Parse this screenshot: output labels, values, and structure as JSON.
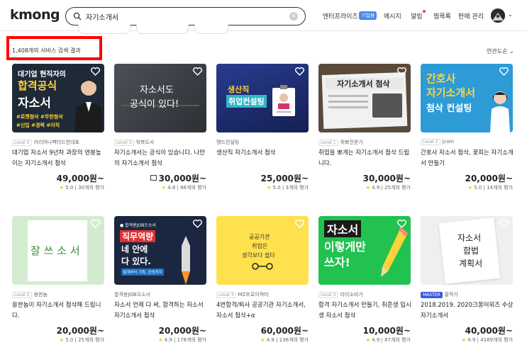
{
  "header": {
    "logo": "kmong",
    "search_value": "자기소개서",
    "search_placeholder": "",
    "nav": {
      "enterprise": "엔터프라이즈",
      "enterprise_badge": "기업용",
      "messages": "메시지",
      "alarm": "알림",
      "favorites": "찜목록",
      "sell": "판매 관리"
    }
  },
  "results": {
    "count_label": "1,408개의 서비스 검색 결과",
    "sort_label": "연관도순"
  },
  "cards": [
    {
      "thumb_lines": [
        "대기업 현직자의",
        "합격공식",
        "자소서",
        "#로켓첨삭 #무한첨삭",
        "#신입 #경력 #이직"
      ],
      "level": "Level 2",
      "seller": "카리어나벽터드한대표",
      "title": "대기업 자소서 9년차 과장의 연봉높이는 자기소개서 첨삭",
      "price": "49,000원~",
      "rating": "5.0",
      "reviews": "30개의 평가"
    },
    {
      "thumb_lines": [
        "자소서도",
        "공식이 있다!"
      ],
      "level": "Level 3",
      "seller": "워북도사",
      "title": "자기소개서는 공식이 있습니다. 나만의 자기소개서 첨삭",
      "price": "30,000원~",
      "rating": "4.8",
      "reviews": "86개의 평가"
    },
    {
      "thumb_lines": [
        "생산직",
        "취업컨설팅"
      ],
      "level": "",
      "seller": "땡드컨설팅",
      "title": "생산직 자기소개서 첨삭",
      "price": "25,000원~",
      "rating": "5.0",
      "reviews": "3개의 평가"
    },
    {
      "thumb_lines": [
        "자기소개서 첨삭"
      ],
      "level": "Level 1",
      "seller": "취뽀전문가",
      "title": "취업을 뽀개는 자기소개서 첨삭 드립니다.",
      "price": "30,000원~",
      "rating": "4.9",
      "reviews": "25개의 평가"
    },
    {
      "thumb_lines": [
        "간호사",
        "자기소개서",
        "첨삭 컨설팅"
      ],
      "level": "Level 2",
      "seller": "jcoin",
      "title": "간호사 자소서 첨삭, 꽃피는 자기소개서 만들기",
      "price": "20,000원~",
      "rating": "5.0",
      "reviews": "14개의 평가"
    },
    {
      "thumb_lines": [
        "잘 쓰 소 서"
      ],
      "level": "Level 2",
      "seller": "용한놈",
      "title": "용한놈이 자기소개서 첨삭해 드립니다.",
      "price": "20,000원~",
      "rating": "5.0",
      "reviews": "25개의 평가"
    },
    {
      "thumb_lines": [
        "● 합격용JOB으소서",
        "직무역량",
        "네 안에",
        "다 있다.",
        "설계부터 기획, 완성까지"
      ],
      "level": "",
      "seller": "합격용JOB으소서",
      "title": "자소서 언제 다 써, 합격하는 자소서 자기소개서 첨삭",
      "price": "20,000원~",
      "rating": "4.9",
      "reviews": "178개의 평가"
    },
    {
      "thumb_lines": [
        "공공기관",
        "취업은",
        "생각보다 쉽다"
      ],
      "level": "Level 3",
      "seller": "MZ프로이적러",
      "title": "4번합격/퇴사 공공기관 자기소개서,자소서 첨삭+α",
      "price": "60,000원~",
      "rating": "4.9",
      "reviews": "136개의 평가"
    },
    {
      "thumb_lines": [
        "자소서",
        "이렇게만",
        "쓰자!"
      ],
      "level": "Level 3",
      "seller": "라이소비기",
      "title": "합격 자기소개서 만들기, 취준생 입시생 자소서 첨삭",
      "price": "10,000원~",
      "rating": "4.9",
      "reviews": "87개의 평가"
    },
    {
      "thumb_lines": [
        "자소서",
        "합법",
        "계획서"
      ],
      "level": "MASTER",
      "seller": "황작가",
      "title": "2018.2019. 2020크몽어워즈 수상 자기소개서",
      "price": "40,000원~",
      "rating": "4.9",
      "reviews": "4169개의 평가"
    }
  ],
  "colors": {
    "highlight_box": "#ff0000",
    "accent": "#ffc107"
  }
}
